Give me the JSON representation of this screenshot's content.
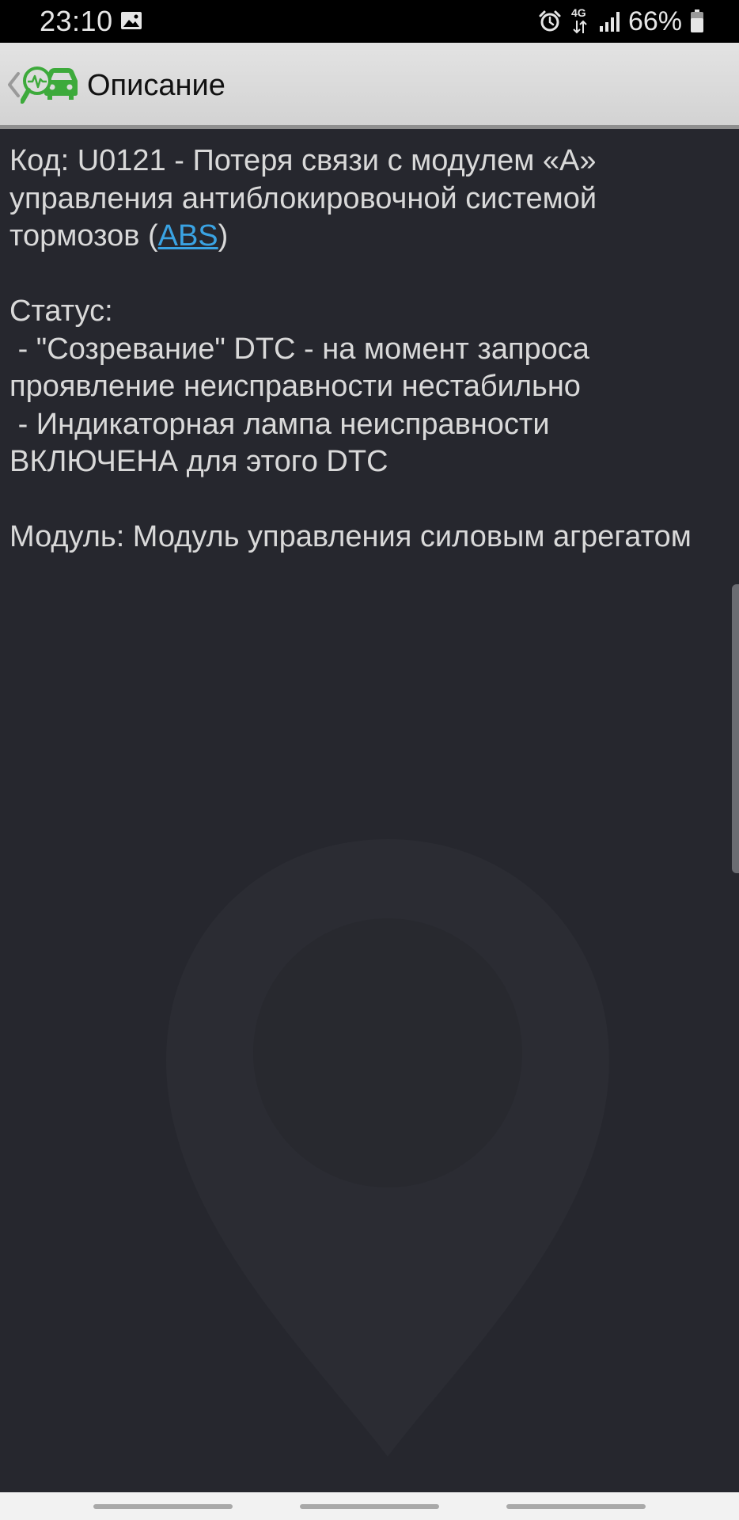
{
  "status_bar": {
    "time": "23:10",
    "network": "4G",
    "battery": "66%",
    "icons": [
      "gallery-icon",
      "alarm-icon",
      "network-arrows-icon",
      "signal-icon",
      "battery-icon"
    ]
  },
  "app_bar": {
    "title": "Описание",
    "logo_color": "#3daa3b",
    "icons": [
      "back-chevron-icon",
      "car-diagnostics-logo-icon"
    ]
  },
  "content": {
    "code_line_prefix": "Код: U0121 - Потеря связи с модулем «A» управления антиблокировочной системой тормозов (",
    "code_link": "ABS",
    "code_line_suffix": ")",
    "status_label": "Статус:",
    "status_item_1": " - \"Созревание\" DTC - на момент запроса проявление неисправности нестабильно",
    "status_item_2": " - Индикаторная лампа неисправности ВКЛЮЧЕНА для этого DTC",
    "module_line": "Модуль: Модуль управления силовым агрегатом",
    "link_color": "#3aa3e3"
  },
  "colors": {
    "background": "#26272e",
    "text": "#d9d9d9",
    "app_bar": "#dcdcdc"
  }
}
